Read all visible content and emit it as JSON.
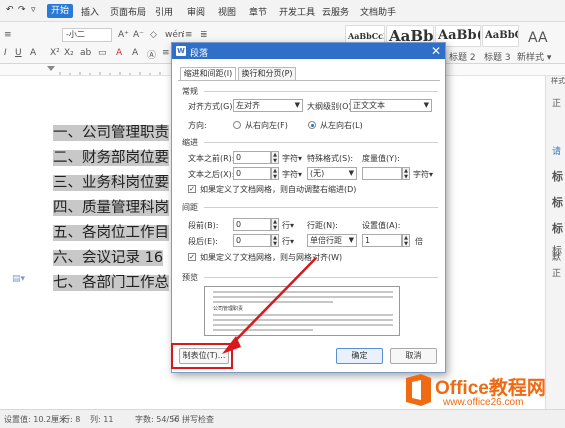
{
  "menubar": {
    "items": [
      "开始",
      "插入",
      "页面布局",
      "引用",
      "审阅",
      "视图",
      "章节",
      "开发工具",
      "云服务",
      "文档助手"
    ]
  },
  "ribbon": {
    "font_size": "-小二",
    "style_samples": [
      "AaBbCcI",
      "AaBb",
      "AaBb(",
      "AaBbC("
    ],
    "heading2": "标题 2",
    "heading3": "标题 3",
    "new_style": "新样式 ▾",
    "aa_label": "AA"
  },
  "document": {
    "lines": [
      "一、公司管理职责",
      "二、财务部岗位要",
      "三、业务科岗位要",
      "四、质量管理科岗",
      "五、各岗位工作目",
      "六、会议记录 16",
      "七、各部门工作总"
    ]
  },
  "right_panel": {
    "label": "样式",
    "chars": [
      "正",
      "请",
      "标",
      "标",
      "标",
      "标",
      "默",
      "正"
    ]
  },
  "status": {
    "page_settings": "设置值: 10.2厘米",
    "row": "行: 8",
    "col": "列: 11",
    "word_count": "字数: 54/56",
    "spell_check": "拼写检查"
  },
  "dialog": {
    "title": "段落",
    "tabs": [
      "缩进和间距(I)",
      "换行和分页(P)"
    ],
    "general": {
      "section": "常规",
      "alignment_label": "对齐方式(G):",
      "alignment_value": "左对齐",
      "outline_label": "大纲级别(O):",
      "outline_value": "正文文本",
      "direction_label": "方向:",
      "rtl_label": "从右向左(F)",
      "ltr_label": "从左向右(L)"
    },
    "indent": {
      "section": "缩进",
      "before_label": "文本之前(R):",
      "before_value": "0",
      "after_label": "文本之后(X):",
      "after_value": "0",
      "unit": "字符▾",
      "special_label": "特殊格式(S):",
      "special_value": "(无)",
      "by_label": "度量值(Y):",
      "by_unit": "字符▾",
      "grid_check": "如果定义了文档网格，则自动调整右缩进(D)"
    },
    "spacing": {
      "section": "间距",
      "before_label": "段前(B):",
      "before_value": "0",
      "after_label": "段后(E):",
      "after_value": "0",
      "unit": "行▾",
      "line_label": "行距(N):",
      "line_value": "单倍行距",
      "at_label": "设置值(A):",
      "at_value": "1",
      "at_unit": "倍",
      "grid_check": "如果定义了文档网格，则与网格对齐(W)"
    },
    "preview": {
      "section": "预览",
      "sample": "公司管理职责"
    },
    "buttons": {
      "tabs": "制表位(T)...",
      "ok": "确定",
      "cancel": "取消"
    }
  },
  "watermark": {
    "brand": "Office教程网",
    "url": "www.office26.com"
  },
  "colors": {
    "accent_blue": "#2b79d6",
    "annotation_red": "#d9181c",
    "watermark_orange": "#ef6a13"
  }
}
